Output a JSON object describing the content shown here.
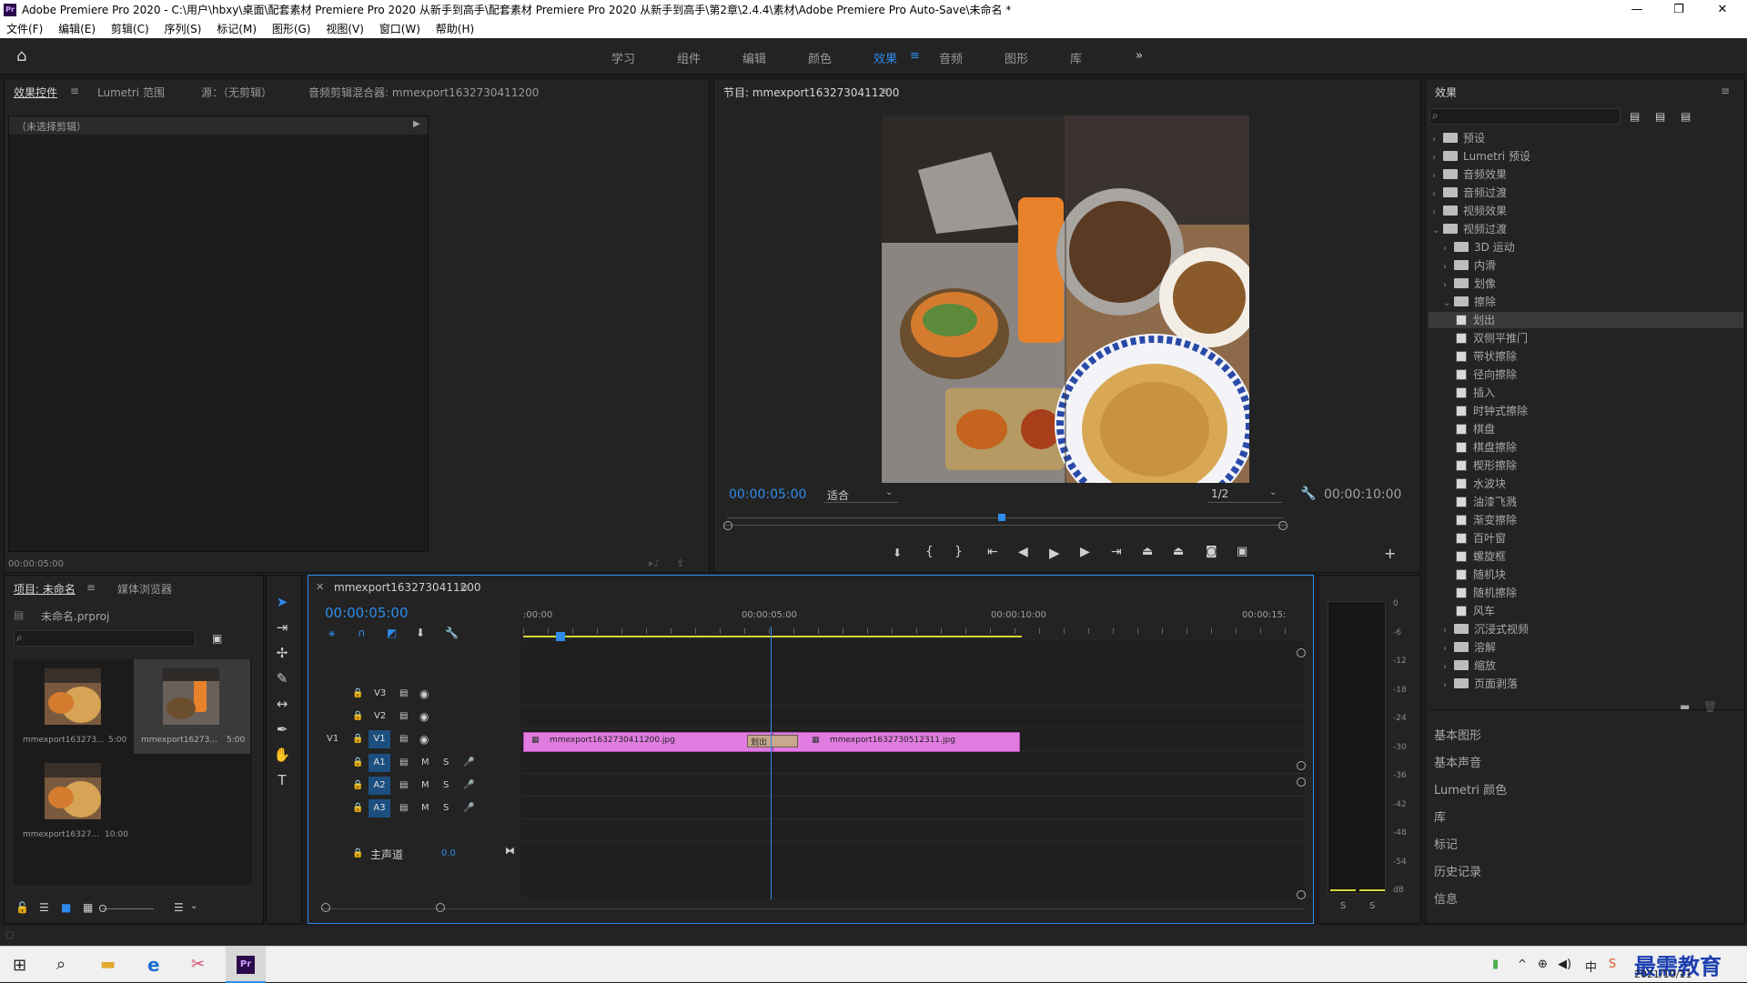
{
  "window": {
    "app_icon": "Pr",
    "title": "Adobe Premiere Pro 2020 - C:\\用户\\hbxy\\桌面\\配套素材 Premiere Pro 2020 从新手到高手\\配套素材 Premiere Pro 2020 从新手到高手\\第2章\\2.4.4\\素材\\Adobe Premiere Pro Auto-Save\\未命名 *",
    "minimize": "—",
    "maximize": "❐",
    "close": "✕"
  },
  "menu": [
    "文件(F)",
    "编辑(E)",
    "剪辑(C)",
    "序列(S)",
    "标记(M)",
    "图形(G)",
    "视图(V)",
    "窗口(W)",
    "帮助(H)"
  ],
  "workspaces": {
    "items": [
      "学习",
      "组件",
      "编辑",
      "颜色",
      "效果",
      "音频",
      "图形",
      "库"
    ],
    "active": "效果",
    "more": "»"
  },
  "source_panel": {
    "tabs": [
      "效果控件",
      "Lumetri 范围",
      "源：（无剪辑）",
      "音频剪辑混合器: mmexport1632730411200"
    ],
    "no_clip": "（未选择剪辑）",
    "timecode": "00:00:05:00"
  },
  "program_monitor": {
    "title": "节目: mmexport1632730411200",
    "timecode": "00:00:05:00",
    "fit": "适合",
    "resolution": "1/2",
    "duration": "00:00:10:00"
  },
  "effects_panel": {
    "title": "效果",
    "tree": [
      {
        "label": "预设",
        "level": 0,
        "type": "folder",
        "state": "collapsed"
      },
      {
        "label": "Lumetri 预设",
        "level": 0,
        "type": "folder",
        "state": "collapsed"
      },
      {
        "label": "音频效果",
        "level": 0,
        "type": "folder",
        "state": "collapsed"
      },
      {
        "label": "音频过渡",
        "level": 0,
        "type": "folder",
        "state": "collapsed"
      },
      {
        "label": "视频效果",
        "level": 0,
        "type": "folder",
        "state": "collapsed"
      },
      {
        "label": "视频过渡",
        "level": 0,
        "type": "folder",
        "state": "expanded"
      },
      {
        "label": "3D 运动",
        "level": 1,
        "type": "folder",
        "state": "collapsed"
      },
      {
        "label": "内滑",
        "level": 1,
        "type": "folder",
        "state": "collapsed"
      },
      {
        "label": "划像",
        "level": 1,
        "type": "folder",
        "state": "collapsed"
      },
      {
        "label": "擦除",
        "level": 1,
        "type": "folder",
        "state": "expanded"
      },
      {
        "label": "划出",
        "level": 2,
        "type": "effect",
        "selected": true
      },
      {
        "label": "双侧平推门",
        "level": 2,
        "type": "effect"
      },
      {
        "label": "带状擦除",
        "level": 2,
        "type": "effect"
      },
      {
        "label": "径向擦除",
        "level": 2,
        "type": "effect"
      },
      {
        "label": "插入",
        "level": 2,
        "type": "effect"
      },
      {
        "label": "时钟式擦除",
        "level": 2,
        "type": "effect"
      },
      {
        "label": "棋盘",
        "level": 2,
        "type": "effect"
      },
      {
        "label": "棋盘擦除",
        "level": 2,
        "type": "effect"
      },
      {
        "label": "楔形擦除",
        "level": 2,
        "type": "effect"
      },
      {
        "label": "水波块",
        "level": 2,
        "type": "effect"
      },
      {
        "label": "油漆飞溅",
        "level": 2,
        "type": "effect"
      },
      {
        "label": "渐变擦除",
        "level": 2,
        "type": "effect"
      },
      {
        "label": "百叶窗",
        "level": 2,
        "type": "effect"
      },
      {
        "label": "螺旋框",
        "level": 2,
        "type": "effect"
      },
      {
        "label": "随机块",
        "level": 2,
        "type": "effect"
      },
      {
        "label": "随机擦除",
        "level": 2,
        "type": "effect"
      },
      {
        "label": "风车",
        "level": 2,
        "type": "effect"
      },
      {
        "label": "沉浸式视频",
        "level": 1,
        "type": "folder",
        "state": "collapsed"
      },
      {
        "label": "溶解",
        "level": 1,
        "type": "folder",
        "state": "collapsed"
      },
      {
        "label": "缩放",
        "level": 1,
        "type": "folder",
        "state": "collapsed"
      },
      {
        "label": "页面剥落",
        "level": 1,
        "type": "folder",
        "state": "collapsed"
      }
    ],
    "sections": [
      "基本图形",
      "基本声音",
      "Lumetri 颜色",
      "库",
      "标记",
      "历史记录",
      "信息"
    ]
  },
  "project_panel": {
    "tabs": [
      "项目: 未命名",
      "媒体浏览器"
    ],
    "file": "未命名.prproj",
    "items": [
      {
        "name": "mmexport163273...",
        "duration": "5:00"
      },
      {
        "name": "mmexport16273...",
        "duration": "5:00"
      },
      {
        "name": "mmexport16327...",
        "duration": "10:00"
      }
    ]
  },
  "timeline": {
    "sequence_tab": "mmexport1632730411200",
    "timecode": "00:00:05:00",
    "ruler": [
      ":00:00",
      "00:00:05:00",
      "00:00:10:00",
      "00:00:15:"
    ],
    "tracks": [
      {
        "id": "V3",
        "controls": [
          "V3"
        ]
      },
      {
        "id": "V2",
        "controls": [
          "V2"
        ]
      },
      {
        "id": "V1",
        "source": "V1"
      },
      {
        "id": "A1"
      },
      {
        "id": "A2"
      },
      {
        "id": "A3"
      }
    ],
    "master": {
      "label": "主声道",
      "value": "0.0"
    },
    "clips": [
      {
        "name": "mmexport1632730411200.jpg",
        "track": "V1"
      },
      {
        "name": "mmexport1632730512311.jpg",
        "track": "V1"
      }
    ],
    "transition": "划出",
    "mute": "M",
    "solo": "S"
  },
  "audio_meter": {
    "scale": [
      "0",
      "-6",
      "-12",
      "-18",
      "-24",
      "-30",
      "-36",
      "-42",
      "-48",
      "-54",
      "dB"
    ],
    "solo_labels": [
      "S",
      "S"
    ]
  },
  "taskbar": {
    "date": "2021/10/11",
    "ime": "中",
    "watermark": "最需教育"
  },
  "colors": {
    "accent": "#2d8ceb",
    "clip": "#e07ce0",
    "transition": "#c7a88c",
    "playhead": "#2d8ceb"
  }
}
